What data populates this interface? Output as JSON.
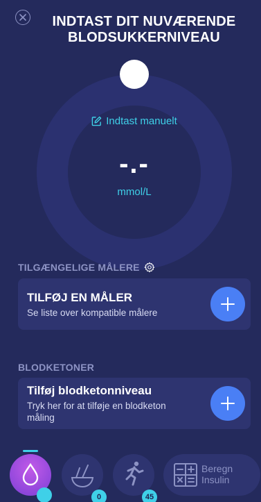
{
  "header": {
    "title_line1": "INDTAST DIT NUVÆRENDE",
    "title_line2": "BLODSUKKERNIVEAU"
  },
  "dial": {
    "manual_entry_label": "Indtast manuelt",
    "reading": "-.-",
    "unit": "mmol/L"
  },
  "meters": {
    "section_label": "TILGÆNGELIGE MÅLERE",
    "card_title": "TILFØJ EN MÅLER",
    "card_subtitle": "Se liste over kompatible målere"
  },
  "ketones": {
    "section_label": "BLODKETONER",
    "card_title": "Tilføj blodketonniveau",
    "card_subtitle_line1": "Tryk her for at tilføje en blodketon",
    "card_subtitle_line2": "måling"
  },
  "bottom_nav": {
    "food_badge": "0",
    "activity_badge": "45",
    "calc_label_line1": "Beregn",
    "calc_label_line2": "Insulin"
  },
  "colors": {
    "background": "#242a5c",
    "card": "#2e3470",
    "accent": "#3fd0e8",
    "button": "#4a7ff5"
  }
}
